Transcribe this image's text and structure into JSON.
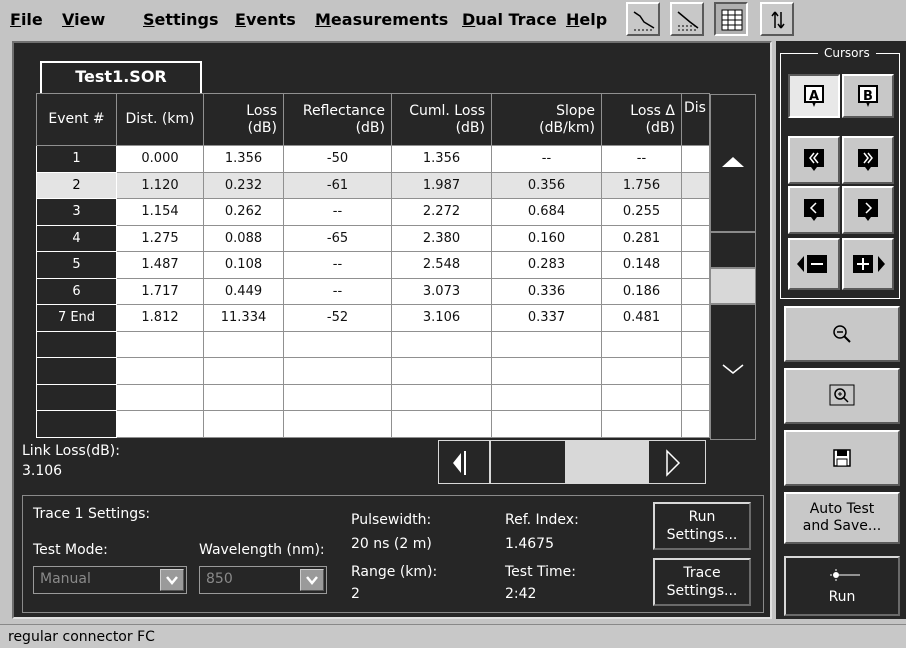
{
  "menu": {
    "items": [
      "File",
      "View",
      "Settings",
      "Events",
      "Measurements",
      "Dual Trace",
      "Help"
    ]
  },
  "toolbar": {
    "icons": [
      "trace-zoom-icon",
      "trace-overlay-icon",
      "table-view-icon",
      "swap-icon"
    ]
  },
  "file_tab": "Test1.SOR",
  "table": {
    "headers": [
      "Event #",
      "Dist. (km)",
      "Loss\n(dB)",
      "Reflectance\n(dB)",
      "Cuml. Loss\n(dB)",
      "Slope\n(dB/km)",
      "Loss Δ\n(dB)",
      "Dis"
    ],
    "rows": [
      [
        "1",
        "0.000",
        "1.356",
        "-50",
        "1.356",
        "--",
        "--",
        ""
      ],
      [
        "2",
        "1.120",
        "0.232",
        "-61",
        "1.987",
        "0.356",
        "1.756",
        ""
      ],
      [
        "3",
        "1.154",
        "0.262",
        "--",
        "2.272",
        "0.684",
        "0.255",
        ""
      ],
      [
        "4",
        "1.275",
        "0.088",
        "-65",
        "2.380",
        "0.160",
        "0.281",
        ""
      ],
      [
        "5",
        "1.487",
        "0.108",
        "--",
        "2.548",
        "0.283",
        "0.148",
        ""
      ],
      [
        "6",
        "1.717",
        "0.449",
        "--",
        "3.073",
        "0.336",
        "0.186",
        ""
      ],
      [
        "7 End",
        "1.812",
        "11.334",
        "-52",
        "3.106",
        "0.337",
        "0.481",
        ""
      ]
    ],
    "selected_row": 1,
    "empty_rows": 4
  },
  "link_loss": {
    "label": "Link Loss(dB):",
    "value": "3.106"
  },
  "settings": {
    "title": "Trace 1 Settings:",
    "test_mode_label": "Test Mode:",
    "test_mode_value": "Manual",
    "wavelength_label": "Wavelength (nm):",
    "wavelength_value": "850",
    "pulsewidth_label": "Pulsewidth:",
    "pulsewidth_value": "20 ns (2 m)",
    "range_label": "Range (km):",
    "range_value": "2",
    "ref_index_label": "Ref. Index:",
    "ref_index_value": "1.4675",
    "test_time_label": "Test Time:",
    "test_time_value": "2:42",
    "run_settings_label": "Run\nSettings...",
    "trace_settings_label": "Trace\nSettings..."
  },
  "cursors": {
    "title": "Cursors",
    "a_label": "A",
    "b_label": "B"
  },
  "right_buttons": {
    "auto_test_label": "Auto Test\nand Save...",
    "run_label": "Run"
  },
  "status_text": "regular connector FC"
}
